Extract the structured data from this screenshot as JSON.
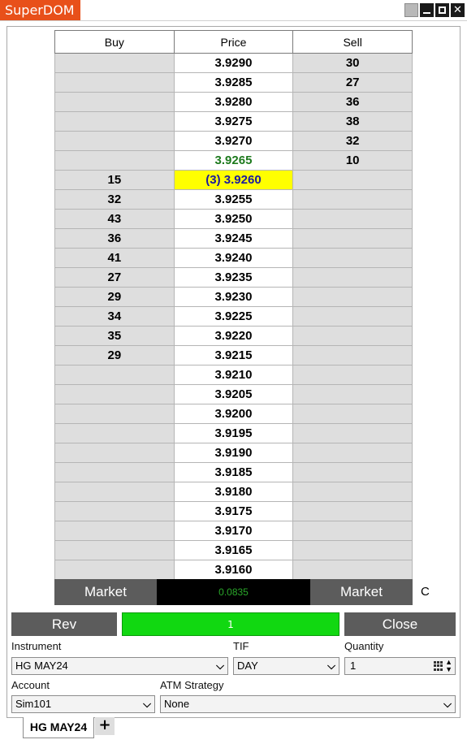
{
  "window": {
    "title": "SuperDOM"
  },
  "ladder": {
    "headers": {
      "buy": "Buy",
      "price": "Price",
      "sell": "Sell"
    },
    "rows": [
      {
        "buy": "",
        "price": "3.9290",
        "sell": "30",
        "state": ""
      },
      {
        "buy": "",
        "price": "3.9285",
        "sell": "27",
        "state": ""
      },
      {
        "buy": "",
        "price": "3.9280",
        "sell": "36",
        "state": ""
      },
      {
        "buy": "",
        "price": "3.9275",
        "sell": "38",
        "state": ""
      },
      {
        "buy": "",
        "price": "3.9270",
        "sell": "32",
        "state": ""
      },
      {
        "buy": "",
        "price": "3.9265",
        "sell": "10",
        "state": "last"
      },
      {
        "buy": "15",
        "price": "(3) 3.9260",
        "sell": "",
        "state": "pos"
      },
      {
        "buy": "32",
        "price": "3.9255",
        "sell": "",
        "state": ""
      },
      {
        "buy": "43",
        "price": "3.9250",
        "sell": "",
        "state": ""
      },
      {
        "buy": "36",
        "price": "3.9245",
        "sell": "",
        "state": ""
      },
      {
        "buy": "41",
        "price": "3.9240",
        "sell": "",
        "state": ""
      },
      {
        "buy": "27",
        "price": "3.9235",
        "sell": "",
        "state": ""
      },
      {
        "buy": "29",
        "price": "3.9230",
        "sell": "",
        "state": ""
      },
      {
        "buy": "34",
        "price": "3.9225",
        "sell": "",
        "state": ""
      },
      {
        "buy": "35",
        "price": "3.9220",
        "sell": "",
        "state": ""
      },
      {
        "buy": "29",
        "price": "3.9215",
        "sell": "",
        "state": ""
      },
      {
        "buy": "",
        "price": "3.9210",
        "sell": "",
        "state": ""
      },
      {
        "buy": "",
        "price": "3.9205",
        "sell": "",
        "state": ""
      },
      {
        "buy": "",
        "price": "3.9200",
        "sell": "",
        "state": ""
      },
      {
        "buy": "",
        "price": "3.9195",
        "sell": "",
        "state": ""
      },
      {
        "buy": "",
        "price": "3.9190",
        "sell": "",
        "state": ""
      },
      {
        "buy": "",
        "price": "3.9185",
        "sell": "",
        "state": ""
      },
      {
        "buy": "",
        "price": "3.9180",
        "sell": "",
        "state": ""
      },
      {
        "buy": "",
        "price": "3.9175",
        "sell": "",
        "state": ""
      },
      {
        "buy": "",
        "price": "3.9170",
        "sell": "",
        "state": ""
      },
      {
        "buy": "",
        "price": "3.9165",
        "sell": "",
        "state": ""
      },
      {
        "buy": "",
        "price": "3.9160",
        "sell": "",
        "state": ""
      }
    ]
  },
  "market_row": {
    "buy_market_label": "Market",
    "pnl_value": "0.0835",
    "sell_market_label": "Market",
    "c_label": "C"
  },
  "actions": {
    "rev_label": "Rev",
    "position_qty": "1",
    "close_label": "Close"
  },
  "order_form": {
    "instrument_label": "Instrument",
    "instrument_value": "HG MAY24",
    "tif_label": "TIF",
    "tif_value": "DAY",
    "quantity_label": "Quantity",
    "quantity_value": "1",
    "account_label": "Account",
    "account_value": "Sim101",
    "atm_label": "ATM Strategy",
    "atm_value": "None"
  },
  "tabs": {
    "active_tab": "HG MAY24",
    "add_tab_symbol": "+"
  },
  "colors": {
    "title_accent": "#e8501a",
    "position_highlight": "#ffff00",
    "last_price": "#1e7a1e",
    "position_qty_bg": "#11d811",
    "pnl_text": "#2aa82a"
  },
  "icons": [
    "minimize-icon",
    "maximize-icon",
    "close-icon",
    "calculator-icon",
    "spinner-icon",
    "chevron-down-icon",
    "plus-icon"
  ]
}
